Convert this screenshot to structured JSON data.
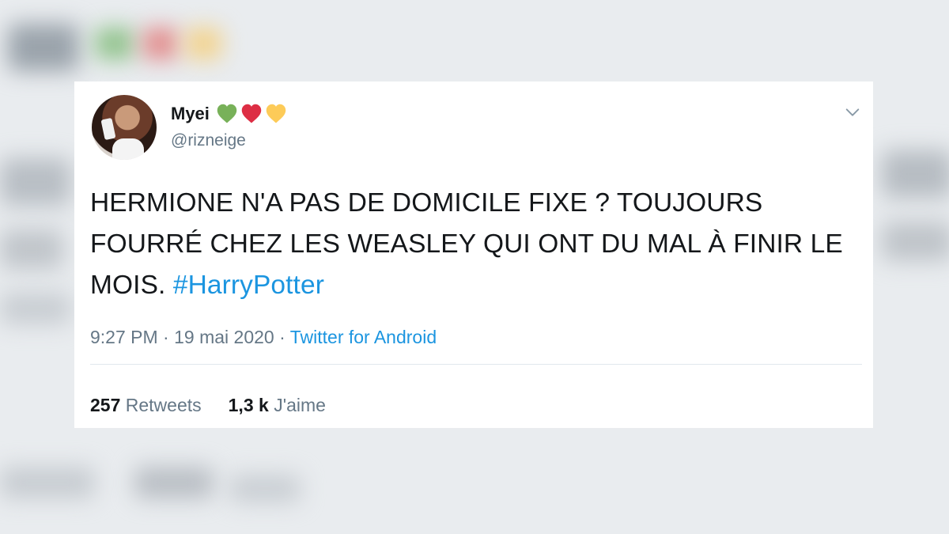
{
  "tweet": {
    "author_name": "Myei",
    "handle": "@rizneige",
    "text": "HERMIONE N'A PAS DE DOMICILE FIXE ? TOUJOURS FOURRÉ CHEZ LES WEASLEY QUI ONT DU MAL À FINIR LE MOIS.",
    "hashtag": "#HarryPotter",
    "time": "9:27 PM",
    "separator": "·",
    "date": "19 mai 2020",
    "source": "Twitter for Android",
    "retweets_count": "257",
    "retweets_label": "Retweets",
    "likes_count": "1,3 k",
    "likes_label": "J'aime"
  },
  "emoji_hearts": [
    {
      "icon": "green-heart-icon",
      "color": "#78b159"
    },
    {
      "icon": "red-heart-icon",
      "color": "#dd2e44"
    },
    {
      "icon": "yellow-heart-icon",
      "color": "#fdcb58"
    }
  ],
  "icons": {
    "menu": "chevron-down-icon"
  },
  "colors": {
    "link": "#1b95e0",
    "secondary_text": "#657786",
    "primary_text": "#14171a"
  }
}
